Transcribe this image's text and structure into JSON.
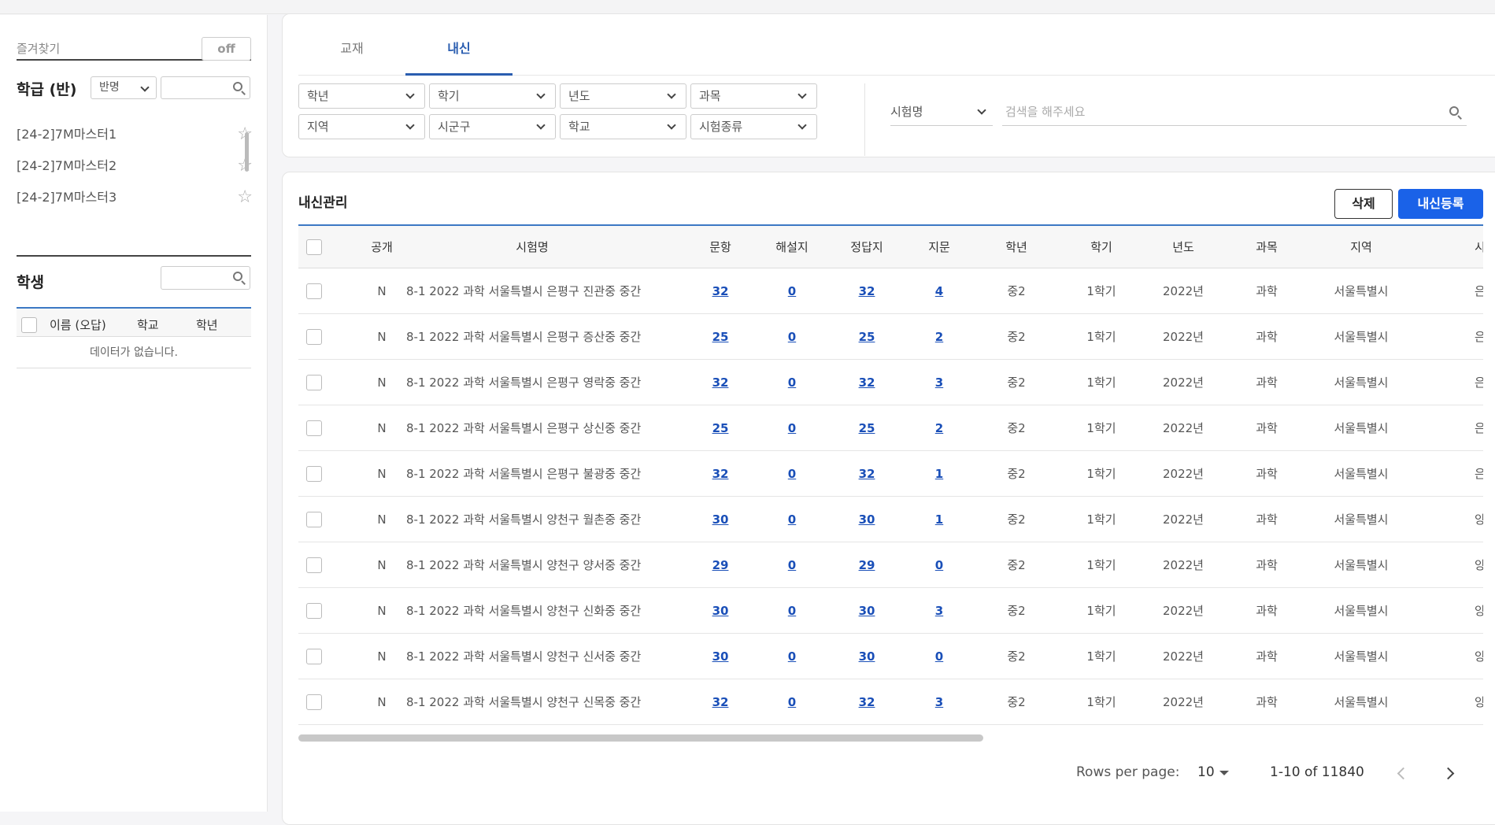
{
  "sidebar": {
    "favorites_label": "즐겨찾기",
    "favorites_toggle": "off",
    "class_title": "학급 (반)",
    "class_select": "반명",
    "classes": [
      {
        "name": "[24-2]7M마스터1"
      },
      {
        "name": "[24-2]7M마스터2"
      },
      {
        "name": "[24-2]7M마스터3"
      }
    ],
    "student_title": "학생",
    "student_headers": [
      "이름 (오답)",
      "학교",
      "학년"
    ],
    "student_empty": "데이터가 없습니다."
  },
  "filters": {
    "tabs": [
      "교재",
      "내신"
    ],
    "active_tab": "내신",
    "selects_row1": [
      "학년",
      "학기",
      "년도",
      "과목"
    ],
    "selects_row2": [
      "지역",
      "시군구",
      "학교",
      "시험종류"
    ],
    "exam_select": "시험명",
    "search_placeholder": "검색을 해주세요"
  },
  "table": {
    "title": "내신관리",
    "delete_label": "삭제",
    "register_label": "내신등록",
    "headers": [
      "공개",
      "시험명",
      "문항",
      "해설지",
      "정답지",
      "지문",
      "학년",
      "학기",
      "년도",
      "과목",
      "지역",
      "시"
    ],
    "rows": [
      {
        "public": "N",
        "name": "8-1 2022 과학 서울특별시 은평구 진관중 중간",
        "q": "32",
        "exp": "0",
        "ans": "32",
        "pas": "4",
        "grade": "중2",
        "sem": "1학기",
        "year": "2022년",
        "subj": "과학",
        "region": "서울특별시",
        "city": "은"
      },
      {
        "public": "N",
        "name": "8-1 2022 과학 서울특별시 은평구 증산중 중간",
        "q": "25",
        "exp": "0",
        "ans": "25",
        "pas": "2",
        "grade": "중2",
        "sem": "1학기",
        "year": "2022년",
        "subj": "과학",
        "region": "서울특별시",
        "city": "은"
      },
      {
        "public": "N",
        "name": "8-1 2022 과학 서울특별시 은평구 영락중 중간",
        "q": "32",
        "exp": "0",
        "ans": "32",
        "pas": "3",
        "grade": "중2",
        "sem": "1학기",
        "year": "2022년",
        "subj": "과학",
        "region": "서울특별시",
        "city": "은"
      },
      {
        "public": "N",
        "name": "8-1 2022 과학 서울특별시 은평구 상신중 중간",
        "q": "25",
        "exp": "0",
        "ans": "25",
        "pas": "2",
        "grade": "중2",
        "sem": "1학기",
        "year": "2022년",
        "subj": "과학",
        "region": "서울특별시",
        "city": "은"
      },
      {
        "public": "N",
        "name": "8-1 2022 과학 서울특별시 은평구 불광중 중간",
        "q": "32",
        "exp": "0",
        "ans": "32",
        "pas": "1",
        "grade": "중2",
        "sem": "1학기",
        "year": "2022년",
        "subj": "과학",
        "region": "서울특별시",
        "city": "은"
      },
      {
        "public": "N",
        "name": "8-1 2022 과학 서울특별시 양천구 월촌중 중간",
        "q": "30",
        "exp": "0",
        "ans": "30",
        "pas": "1",
        "grade": "중2",
        "sem": "1학기",
        "year": "2022년",
        "subj": "과학",
        "region": "서울특별시",
        "city": "양"
      },
      {
        "public": "N",
        "name": "8-1 2022 과학 서울특별시 양천구 양서중 중간",
        "q": "29",
        "exp": "0",
        "ans": "29",
        "pas": "0",
        "grade": "중2",
        "sem": "1학기",
        "year": "2022년",
        "subj": "과학",
        "region": "서울특별시",
        "city": "양"
      },
      {
        "public": "N",
        "name": "8-1 2022 과학 서울특별시 양천구 신화중 중간",
        "q": "30",
        "exp": "0",
        "ans": "30",
        "pas": "3",
        "grade": "중2",
        "sem": "1학기",
        "year": "2022년",
        "subj": "과학",
        "region": "서울특별시",
        "city": "양"
      },
      {
        "public": "N",
        "name": "8-1 2022 과학 서울특별시 양천구 신서중 중간",
        "q": "30",
        "exp": "0",
        "ans": "30",
        "pas": "0",
        "grade": "중2",
        "sem": "1학기",
        "year": "2022년",
        "subj": "과학",
        "region": "서울특별시",
        "city": "양"
      },
      {
        "public": "N",
        "name": "8-1 2022 과학 서울특별시 양천구 신목중 중간",
        "q": "32",
        "exp": "0",
        "ans": "32",
        "pas": "3",
        "grade": "중2",
        "sem": "1학기",
        "year": "2022년",
        "subj": "과학",
        "region": "서울특별시",
        "city": "양"
      }
    ]
  },
  "pagination": {
    "rows_per_page_label": "Rows per page:",
    "rows_per_page": "10",
    "range": "1-10 of 11840"
  }
}
